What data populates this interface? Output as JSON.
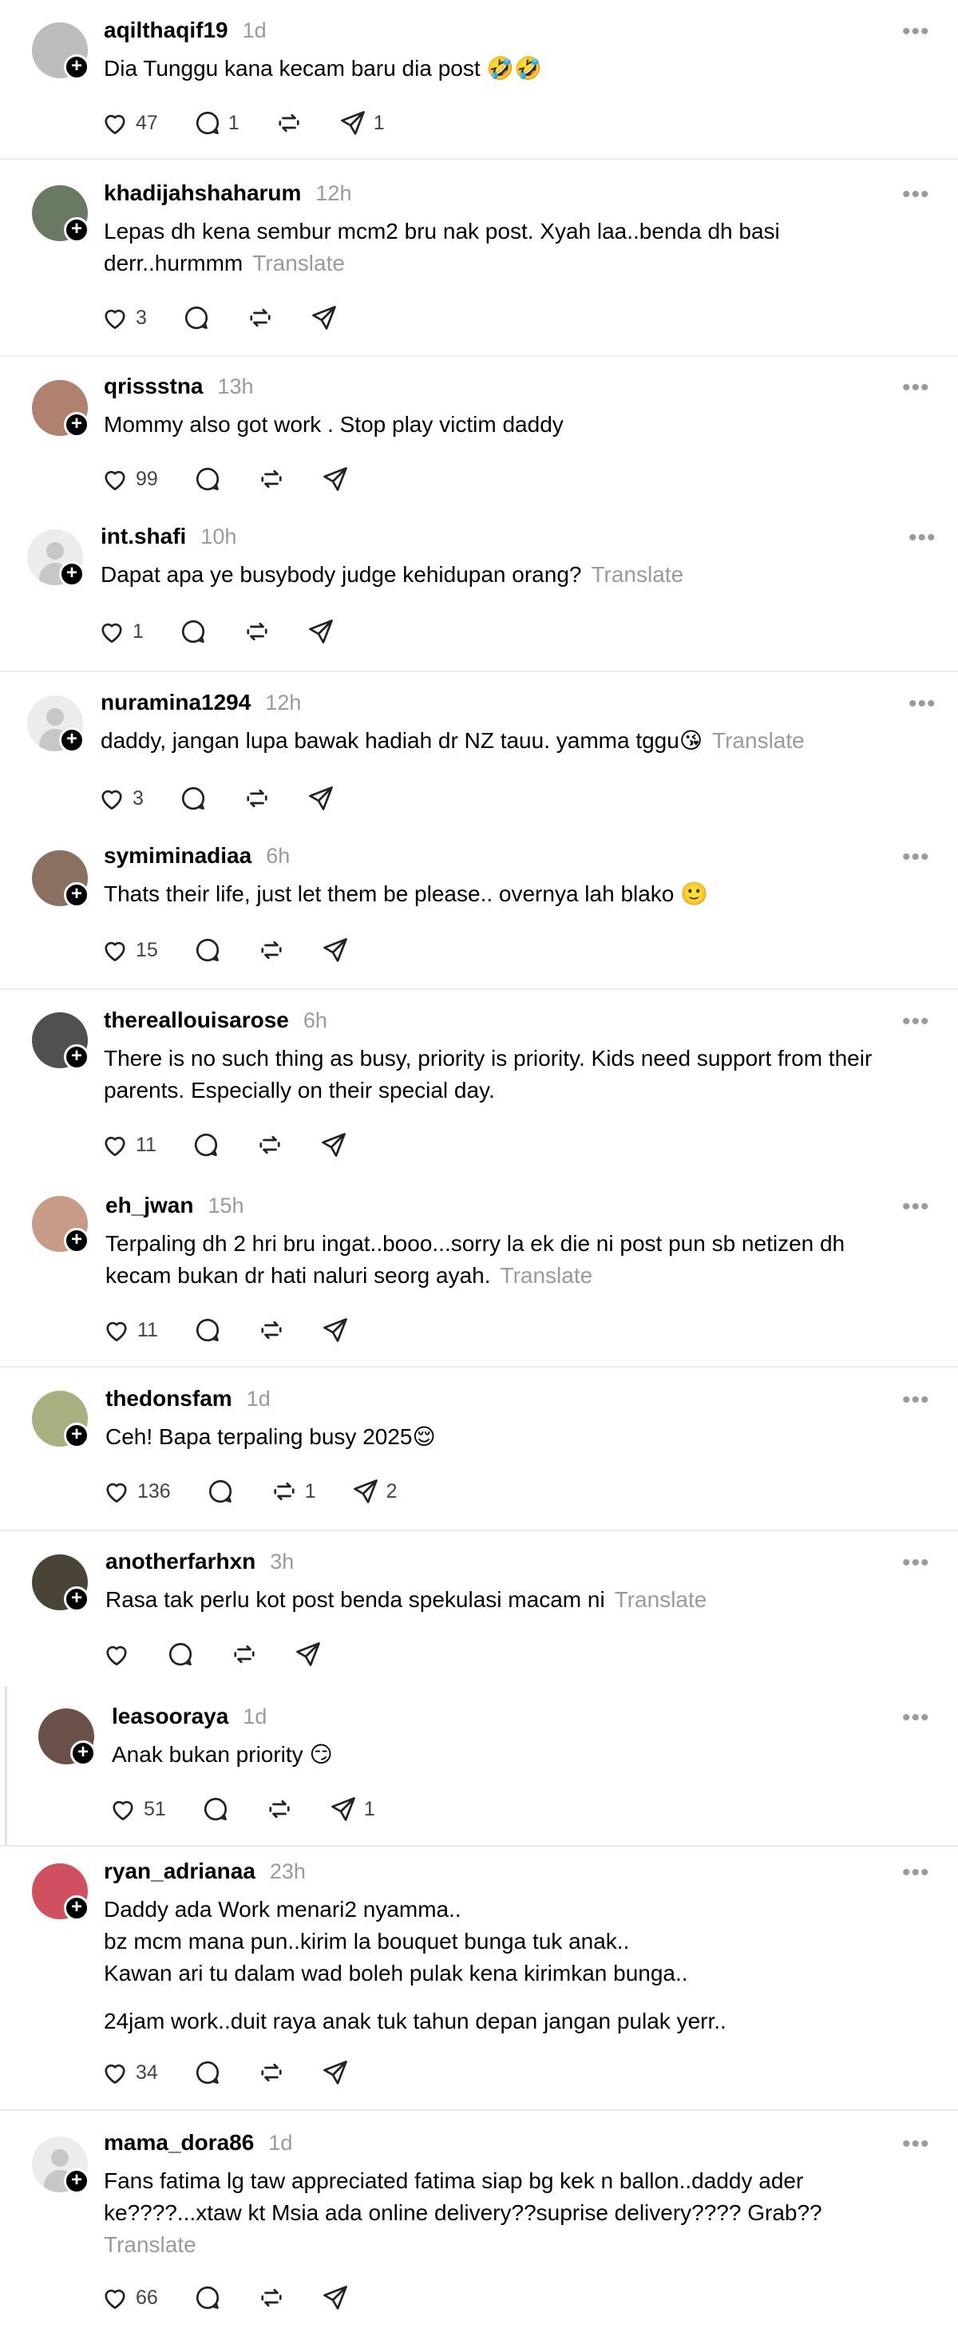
{
  "comments": [
    {
      "username": "aqilthaqif19",
      "time": "1d",
      "text_lines": [
        "Dia Tunggu kana kecam baru dia post 🤣🤣"
      ],
      "translate": "",
      "likes": "47",
      "replies": "1",
      "reposts": "",
      "shares": "1",
      "avatar_color": "#bcbcbc"
    },
    {
      "username": "khadijahshaharum",
      "time": "12h",
      "text_lines": [
        "Lepas dh kena sembur mcm2 bru nak post. Xyah laa..benda dh basi",
        "derr..hurmmm"
      ],
      "translate": "Translate",
      "likes": "3",
      "replies": "",
      "reposts": "",
      "shares": "",
      "avatar_color": "#6a7a62"
    },
    {
      "username": "qrissstna",
      "time": "13h",
      "text_lines": [
        "Mommy also got work . Stop play victim daddy"
      ],
      "translate": "",
      "likes": "99",
      "replies": "",
      "reposts": "",
      "shares": "",
      "avatar_color": "#b08070"
    },
    {
      "username": "int.shafi",
      "time": "10h",
      "text_lines": [
        "Dapat apa ye busybody judge kehidupan orang?"
      ],
      "translate": "Translate",
      "likes": "1",
      "replies": "",
      "reposts": "",
      "shares": "",
      "avatar_color": "default"
    },
    {
      "username": "nuramina1294",
      "time": "12h",
      "text_lines": [
        "daddy, jangan lupa bawak hadiah dr NZ tauu. yamma tggu😘"
      ],
      "translate": "Translate",
      "likes": "3",
      "replies": "",
      "reposts": "",
      "shares": "",
      "avatar_color": "default"
    },
    {
      "username": "symiminadiaa",
      "time": "6h",
      "text_lines": [
        "Thats their life, just let them be please.. overnya lah blako 🙂"
      ],
      "translate": "",
      "likes": "15",
      "replies": "",
      "reposts": "",
      "shares": "",
      "avatar_color": "#8a7060"
    },
    {
      "username": "thereallouisarose",
      "time": "6h",
      "text_lines": [
        "There is no such thing as busy, priority is priority. Kids need support from their",
        "parents. Especially on their special day."
      ],
      "translate": "",
      "likes": "11",
      "replies": "",
      "reposts": "",
      "shares": "",
      "avatar_color": "#505050"
    },
    {
      "username": "eh_jwan",
      "time": "15h",
      "text_lines": [
        "Terpaling dh 2 hri bru ingat..booo...sorry la ek die ni post pun sb netizen dh",
        "kecam bukan dr hati naluri seorg ayah."
      ],
      "translate": "Translate",
      "likes": "11",
      "replies": "",
      "reposts": "",
      "shares": "",
      "avatar_color": "#c89a88"
    },
    {
      "username": "thedonsfam",
      "time": "1d",
      "text_lines": [
        "Ceh! Bapa terpaling busy 2025😌"
      ],
      "translate": "",
      "likes": "136",
      "replies": "",
      "reposts": "1",
      "shares": "2",
      "avatar_color": "#a8b080"
    },
    {
      "username": "anotherfarhxn",
      "time": "3h",
      "text_lines": [
        "Rasa tak perlu kot post benda spekulasi macam ni"
      ],
      "translate": "Translate",
      "likes": "",
      "replies": "",
      "reposts": "",
      "shares": "",
      "avatar_color": "#4a4438"
    },
    {
      "username": "leasooraya",
      "time": "1d",
      "text_lines": [
        "Anak bukan priority 😏"
      ],
      "translate": "",
      "likes": "51",
      "replies": "",
      "reposts": "",
      "shares": "1",
      "avatar_color": "#6a5048"
    },
    {
      "username": "ryan_adrianaa",
      "time": "23h",
      "text_lines": [
        "Daddy ada Work menari2 nyamma..",
        "bz mcm mana pun..kirim la bouquet bunga tuk anak..",
        "Kawan ari tu dalam wad boleh pulak kena kirimkan bunga..",
        "",
        "24jam work..duit raya anak tuk tahun depan jangan pulak yerr.."
      ],
      "translate": "",
      "likes": "34",
      "replies": "",
      "reposts": "",
      "shares": "",
      "avatar_color": "#d05060"
    },
    {
      "username": "mama_dora86",
      "time": "1d",
      "text_lines": [
        "Fans fatima lg taw appreciated fatima siap bg kek n ballon..daddy ader",
        "ke????...xtaw kt Msia ada online delivery??suprise delivery???? Grab??"
      ],
      "translate": "Translate",
      "translate_own_line": true,
      "likes": "66",
      "replies": "",
      "reposts": "",
      "shares": "",
      "avatar_color": "default"
    }
  ],
  "icons": {
    "like": "heart-icon",
    "reply": "comment-icon",
    "repost": "repost-icon",
    "share": "share-icon",
    "more": "more-icon",
    "follow": "plus-icon"
  },
  "more_glyph": "•••",
  "follow_glyph": "+"
}
